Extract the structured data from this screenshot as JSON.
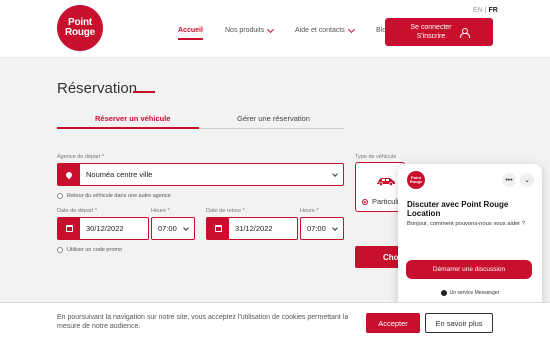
{
  "header": {
    "logo": {
      "line1": "Point",
      "line2": "Rouge"
    },
    "lang": {
      "en": "EN",
      "separator": "|",
      "fr": "FR"
    },
    "nav": {
      "home": "Accueil",
      "products": "Nos produits",
      "help": "Aide et contacts",
      "blog": "Blog"
    },
    "connect": {
      "line1": "Se connecter",
      "line2": "S'inscrire"
    }
  },
  "page": {
    "title": "Réservation",
    "tabs": {
      "reserve": "Réserver un véhicule",
      "manage": "Gérer une réservation"
    }
  },
  "form": {
    "departure_agency": {
      "label": "Agence de départ *",
      "value": "Nouméa centre ville"
    },
    "return_other": "Retour du véhicule dans une autre agence",
    "departure_date": {
      "label": "Date de départ *",
      "value": "30/12/2022"
    },
    "departure_time": {
      "label": "Heure *",
      "value": "07:00"
    },
    "return_date": {
      "label": "Date de retour *",
      "value": "31/12/2022"
    },
    "return_time": {
      "label": "Heure *",
      "value": "07:00"
    },
    "promo": "Utiliser un code promo",
    "vehicle_type": {
      "label": "Type de véhicule",
      "option": "Particuli"
    },
    "choose_button": "Cho"
  },
  "chat": {
    "logo": {
      "line1": "Point",
      "line2": "Rouge"
    },
    "more": "•••",
    "minimize": "⌄",
    "title": "Discuter avec Point Rouge Location",
    "message": "Bonjour, comment pouvons-nous vous aider ?",
    "cta": "Démarrer une discussion",
    "footer": "Un service Messenger"
  },
  "cookie": {
    "text": "En poursuivant la navigation sur notre site, vous acceptez l'utilisation de cookies permettant la mesure de notre audience.",
    "accept": "Accepter",
    "more": "En savoir plus"
  },
  "colors": {
    "brand": "#c8102e"
  }
}
